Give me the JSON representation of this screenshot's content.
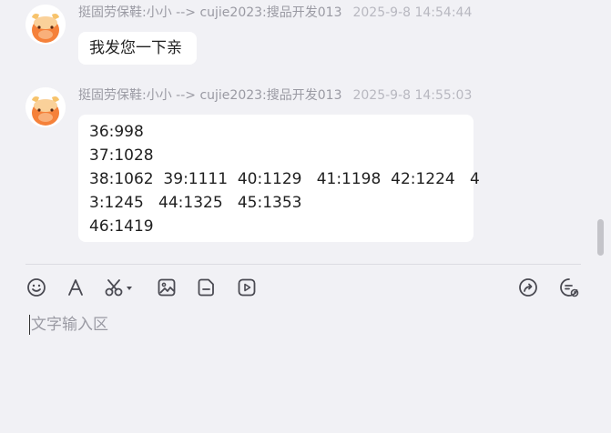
{
  "messages": [
    {
      "sender": "挺固劳保鞋:小小 --> cujie2023:搜品开发013",
      "time": "2025-9-8 14:54:44",
      "lines": [
        "我发您一下亲"
      ]
    },
    {
      "sender": "挺固劳保鞋:小小 --> cujie2023:搜品开发013",
      "time": "2025-9-8 14:55:03",
      "lines": [
        "36:998",
        "37:1028",
        "38:1062  39:1111  40:1129   41:1198  42:1224   4",
        "3:1245   44:1325   45:1353",
        "46:1419"
      ]
    }
  ],
  "toolbar": {
    "left_icons": [
      "emoji-icon",
      "font-icon",
      "scissors-icon",
      "image-icon",
      "file-icon",
      "video-icon"
    ],
    "right_icons": [
      "share-icon",
      "quick-reply-icon"
    ]
  },
  "input": {
    "placeholder": "文字输入区"
  },
  "colors": {
    "background": "#f1f1f5",
    "bubble": "#ffffff",
    "meta_text": "#a9a9b3",
    "avatar_orange": "#f5813a"
  }
}
